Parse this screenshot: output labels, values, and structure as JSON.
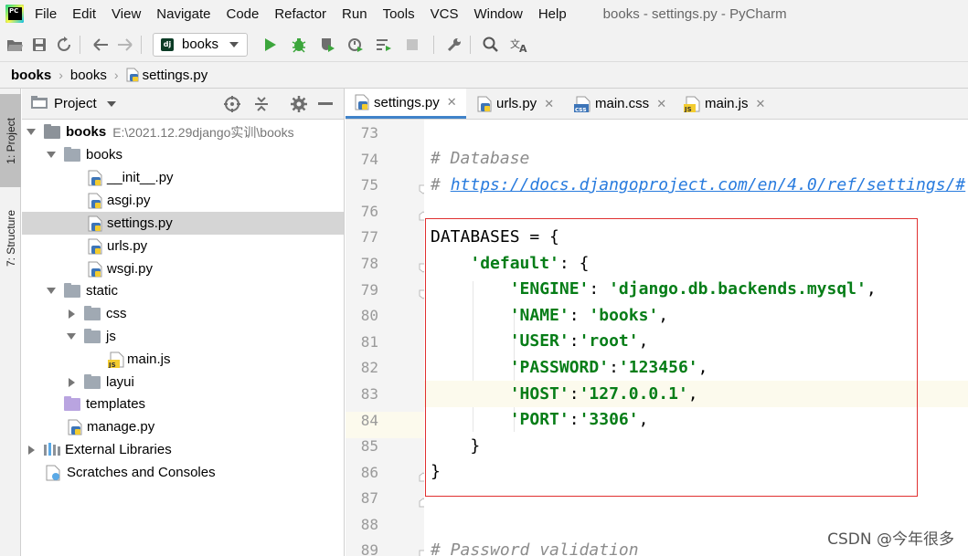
{
  "menubar": {
    "items": [
      "File",
      "Edit",
      "View",
      "Navigate",
      "Code",
      "Refactor",
      "Run",
      "Tools",
      "VCS",
      "Window",
      "Help"
    ],
    "window_title": "books - settings.py - PyCharm"
  },
  "toolbar": {
    "run_config": "books",
    "icons": [
      "open-folder-icon",
      "save-icon",
      "sync-icon",
      "back-arrow-icon",
      "forward-arrow-icon",
      "run-icon",
      "debug-icon",
      "coverage-icon",
      "profile-icon",
      "concurrency-icon",
      "stop-icon",
      "wrench-icon",
      "search-icon",
      "translate-icon"
    ]
  },
  "breadcrumb": [
    "books",
    "books",
    "settings.py"
  ],
  "left_strip": {
    "project_tab": "1: Project",
    "structure_tab": "7: Structure"
  },
  "project_panel": {
    "title": "Project",
    "tree": [
      {
        "label": "books",
        "detail": "E:\\2021.12.29django实训\\books",
        "kind": "root",
        "expanded": true
      },
      {
        "label": "books",
        "kind": "folder",
        "expanded": true
      },
      {
        "label": "__init__.py",
        "kind": "py"
      },
      {
        "label": "asgi.py",
        "kind": "py"
      },
      {
        "label": "settings.py",
        "kind": "py",
        "selected": true
      },
      {
        "label": "urls.py",
        "kind": "py"
      },
      {
        "label": "wsgi.py",
        "kind": "py"
      },
      {
        "label": "static",
        "kind": "folder",
        "expanded": true
      },
      {
        "label": "css",
        "kind": "folder",
        "expanded": false
      },
      {
        "label": "js",
        "kind": "folder",
        "expanded": true
      },
      {
        "label": "main.js",
        "kind": "js"
      },
      {
        "label": "layui",
        "kind": "folder",
        "expanded": false
      },
      {
        "label": "templates",
        "kind": "templates"
      },
      {
        "label": "manage.py",
        "kind": "py"
      },
      {
        "label": "External Libraries",
        "kind": "libraries",
        "expanded": false
      },
      {
        "label": "Scratches and Consoles",
        "kind": "scratches"
      }
    ]
  },
  "editor": {
    "tabs": [
      {
        "label": "settings.py",
        "type": "py",
        "active": true
      },
      {
        "label": "urls.py",
        "type": "py",
        "active": false
      },
      {
        "label": "main.css",
        "type": "css",
        "active": false
      },
      {
        "label": "main.js",
        "type": "js",
        "active": false
      }
    ],
    "lines": [
      {
        "n": "73",
        "text": ""
      },
      {
        "n": "74",
        "text": "# Database"
      },
      {
        "n": "75",
        "text": "# ",
        "link": "https://docs.djangoproject.com/en/4.0/ref/settings/#"
      },
      {
        "n": "76",
        "text": ""
      },
      {
        "n": "77",
        "text": "DATABASES = {"
      },
      {
        "n": "78",
        "indent": "    ",
        "key": "'default'",
        "rest": ": {"
      },
      {
        "n": "79",
        "indent": "        ",
        "key": "'ENGINE'",
        "sep": ": ",
        "val": "'django.db.backends.mysql'",
        "end": ","
      },
      {
        "n": "80",
        "indent": "        ",
        "key": "'NAME'",
        "sep": ": ",
        "val": "'books'",
        "end": ","
      },
      {
        "n": "81",
        "indent": "        ",
        "key": "'USER'",
        "sep": ":",
        "val": "'root'",
        "end": ","
      },
      {
        "n": "82",
        "indent": "        ",
        "key": "'PASSWORD'",
        "sep": ":",
        "val": "'123456'",
        "end": ","
      },
      {
        "n": "83",
        "indent": "        ",
        "key": "'HOST'",
        "sep": ":",
        "val": "'127.0.0.1'",
        "end": ","
      },
      {
        "n": "84",
        "indent": "        ",
        "key": "'PORT'",
        "sep": ":",
        "val": "'3306'",
        "end": ","
      },
      {
        "n": "85",
        "text": "    }"
      },
      {
        "n": "86",
        "text": "}"
      },
      {
        "n": "87",
        "text": ""
      },
      {
        "n": "88",
        "text": ""
      },
      {
        "n": "89",
        "text": "# Password validation"
      }
    ],
    "current_line": "83"
  },
  "watermark": "CSDN @今年很多",
  "colors": {
    "string": "#067d17",
    "comment": "#8c8c8c",
    "link": "#287bde",
    "highlight_box": "#e03030",
    "selection": "#d5d5d5",
    "active_tab_underline": "#4083c9"
  }
}
